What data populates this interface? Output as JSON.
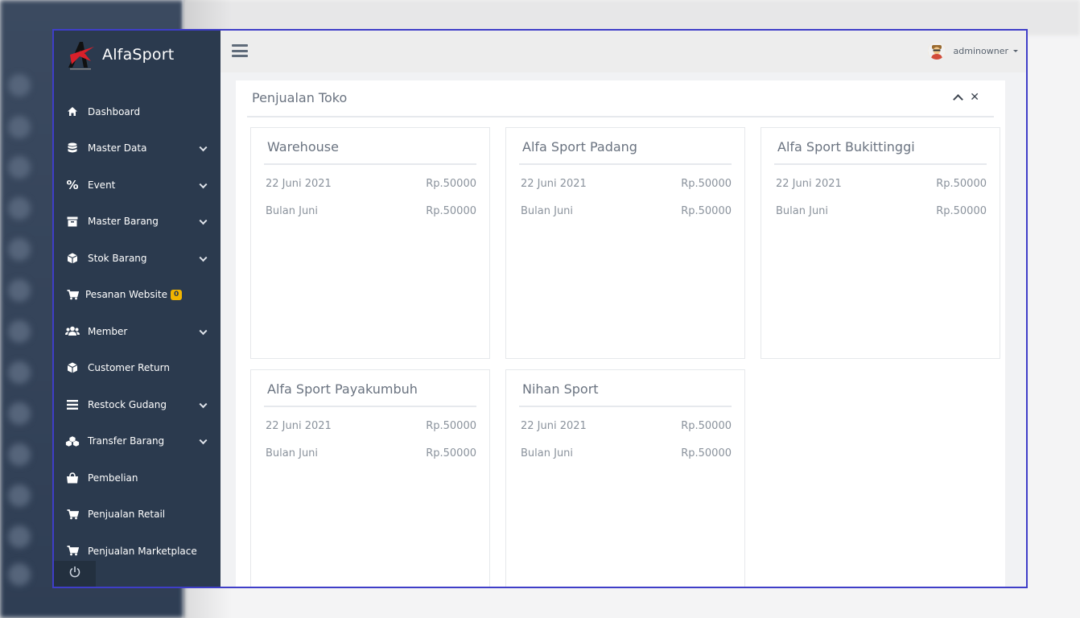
{
  "app": {
    "name": "AlfaSport"
  },
  "sidebar": {
    "items": [
      {
        "label": "Dashboard",
        "icon": "home-icon",
        "has_submenu": false
      },
      {
        "label": "Master Data",
        "icon": "database-icon",
        "has_submenu": true
      },
      {
        "label": "Event",
        "icon": "percent-icon",
        "has_submenu": true
      },
      {
        "label": "Master Barang",
        "icon": "archive-icon",
        "has_submenu": true
      },
      {
        "label": "Stok Barang",
        "icon": "cube-icon",
        "has_submenu": true
      },
      {
        "label": "Pesanan Website",
        "icon": "cart-icon",
        "has_submenu": false,
        "badge": "0"
      },
      {
        "label": "Member",
        "icon": "users-icon",
        "has_submenu": true
      },
      {
        "label": "Customer Return",
        "icon": "cube-icon",
        "has_submenu": false
      },
      {
        "label": "Restock Gudang",
        "icon": "bars-icon",
        "has_submenu": true
      },
      {
        "label": "Transfer Barang",
        "icon": "cubes-icon",
        "has_submenu": true
      },
      {
        "label": "Pembelian",
        "icon": "shopping-bag-icon",
        "has_submenu": false
      },
      {
        "label": "Penjualan Retail",
        "icon": "cart-icon",
        "has_submenu": false
      },
      {
        "label": "Penjualan Marketplace",
        "icon": "cart-icon",
        "has_submenu": false
      }
    ]
  },
  "topnav": {
    "username": "adminowner"
  },
  "panel": {
    "title": "Penjualan Toko",
    "stores": [
      {
        "name": "Warehouse",
        "rows": [
          {
            "label": "22 Juni 2021",
            "value": "Rp.50000"
          },
          {
            "label": "Bulan Juni",
            "value": "Rp.50000"
          }
        ]
      },
      {
        "name": "Alfa Sport Padang",
        "rows": [
          {
            "label": "22 Juni 2021",
            "value": "Rp.50000"
          },
          {
            "label": "Bulan Juni",
            "value": "Rp.50000"
          }
        ]
      },
      {
        "name": "Alfa Sport Bukittinggi",
        "rows": [
          {
            "label": "22 Juni 2021",
            "value": "Rp.50000"
          },
          {
            "label": "Bulan Juni",
            "value": "Rp.50000"
          }
        ]
      },
      {
        "name": "Alfa Sport Payakumbuh",
        "rows": [
          {
            "label": "22 Juni 2021",
            "value": "Rp.50000"
          },
          {
            "label": "Bulan Juni",
            "value": "Rp.50000"
          }
        ]
      },
      {
        "name": "Nihan Sport",
        "rows": [
          {
            "label": "22 Juni 2021",
            "value": "Rp.50000"
          },
          {
            "label": "Bulan Juni",
            "value": "Rp.50000"
          }
        ]
      }
    ]
  },
  "colors": {
    "sidebar": "#2b3a4e",
    "frame_border": "#3f3ec8",
    "badge": "#f0b400",
    "logo_red": "#d8202a"
  }
}
